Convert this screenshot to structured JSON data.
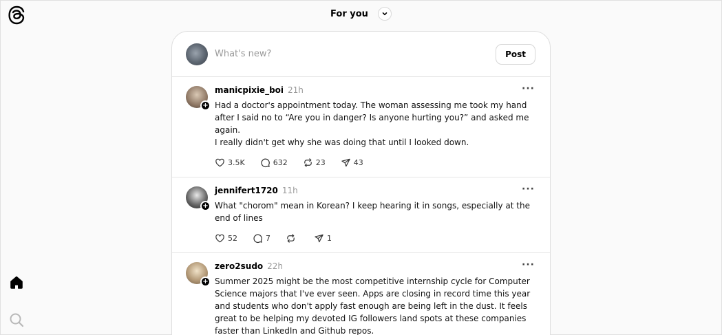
{
  "header": {
    "title": "For you"
  },
  "composer": {
    "placeholder": "What's new?",
    "post_label": "Post"
  },
  "posts": [
    {
      "username": "manicpixie_boi",
      "time": "21h",
      "text": "Had a doctor's appointment today. The woman assessing me took my hand after I said no to “Are you in danger? Is anyone hurting you?” and asked me again.\nI really didn't get why she was doing that until I looked down.",
      "likes": "3.5K",
      "replies": "632",
      "reposts": "23",
      "shares": "43"
    },
    {
      "username": "jennifert1720",
      "time": "11h",
      "text": "What \"chorom\" mean in Korean? I keep hearing it in songs, especially at the end of lines",
      "likes": "52",
      "replies": "7",
      "reposts": "",
      "shares": "1"
    },
    {
      "username": "zero2sudo",
      "time": "22h",
      "text": "Summer 2025 might be the most competitive internship cycle for Computer Science majors that I've ever seen. Apps are closing in record time this year and students who don't apply fast enough are being left in the dust. It feels great to be helping my devoted IG followers land spots at these companies faster than LinkedIn and Github repos.",
      "likes": "",
      "replies": "",
      "reposts": "",
      "shares": ""
    }
  ],
  "icons": {
    "logo": "threads-logo-icon",
    "home": "home-icon",
    "search": "search-icon",
    "like": "heart-icon",
    "reply": "comment-icon",
    "repost": "repost-icon",
    "share": "share-icon",
    "more": "more-icon"
  }
}
